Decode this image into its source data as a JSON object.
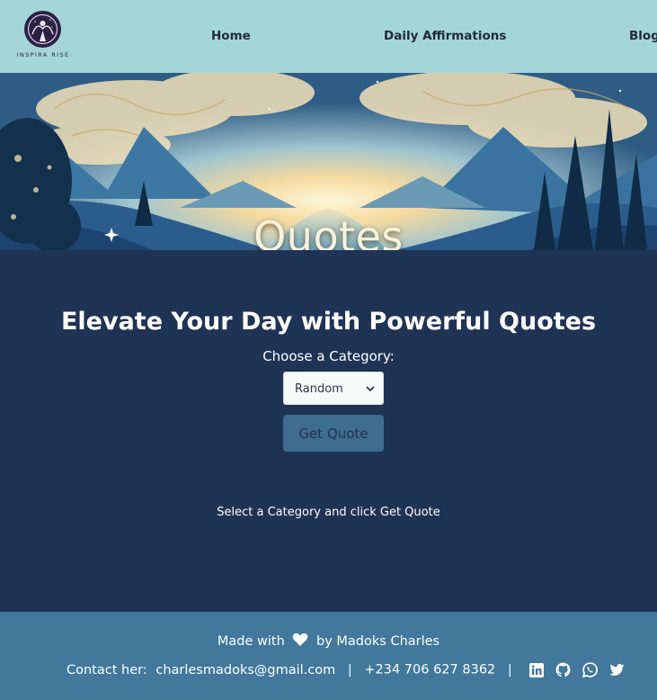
{
  "header": {
    "logo_text": "INSPIRA RISE",
    "nav": {
      "home": "Home",
      "affirmations": "Daily Affirmations",
      "blog": "Blog"
    }
  },
  "hero": {
    "title": "Quotes"
  },
  "main": {
    "heading": "Elevate Your Day with Powerful Quotes",
    "category_label": "Choose a Category:",
    "category_selected": "Random",
    "button_label": "Get Quote",
    "hint": "Select a Category and click Get Quote"
  },
  "footer": {
    "made_prefix": "Made with",
    "made_suffix": "by Madoks Charles",
    "contact_label": "Contact her:",
    "email": "charlesmadoks@gmail.com",
    "divider": "|",
    "phone": "+234 706 627 8362",
    "social_icons": [
      "linkedin-icon",
      "github-icon",
      "whatsapp-icon",
      "twitter-icon"
    ]
  },
  "colors": {
    "header_bg": "#a4d6d9",
    "main_bg": "#1f3354",
    "button_bg": "#3e6d8f",
    "footer_bg": "#41789c"
  }
}
